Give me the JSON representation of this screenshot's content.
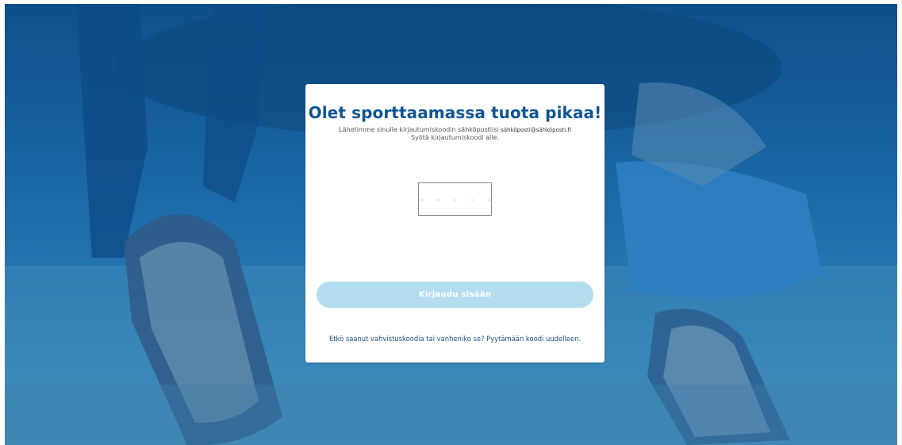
{
  "card": {
    "title": "Olet sporttaamassa tuota pikaa!",
    "desc_line1": "Lähetimme sinulle kirjautumiskoodin sähköpostiisi",
    "email": "sähköposti@sähköposti.fi",
    "desc_line2": "Syötä kirjautumiskoodi alle.",
    "code_placeholder": "- - - - - -",
    "code_value": "",
    "login_label": "Kirjaudu sisään",
    "resend_prefix": "Etkö saanut vahvistuskoodia tai vanheniko se? ",
    "resend_link": "Pyytämään koodi uudelleen."
  },
  "colors": {
    "accent": "#0f5596",
    "button_disabled": "#b4dcef",
    "background_overlay": "#1c6aa8"
  }
}
